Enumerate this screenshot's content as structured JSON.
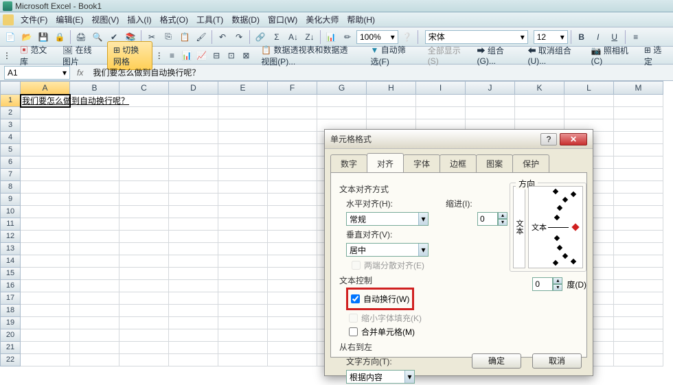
{
  "title": "Microsoft Excel - Book1",
  "menu": {
    "file": "文件(F)",
    "edit": "编辑(E)",
    "view": "视图(V)",
    "insert": "插入(I)",
    "format": "格式(O)",
    "tools": "工具(T)",
    "data": "数据(D)",
    "window": "窗口(W)",
    "beautify": "美化大师",
    "help": "帮助(H)"
  },
  "toolbar": {
    "zoom": "100%",
    "fontname": "宋体",
    "fontsize": "12",
    "bold": "B",
    "italic": "I",
    "underline": "U"
  },
  "strip2": {
    "fanwenku": "范文库",
    "online_image": "在线图片",
    "toggle_grid": "切换网格",
    "pivot": "数据透视表和数据透视图(P)...",
    "auto_filter": "自动筛选(F)",
    "show_all": "全部显示(S)",
    "group": "组合(G)...",
    "ungroup": "取消组合(U)...",
    "camera": "照相机(C)",
    "select": "选定"
  },
  "formula": {
    "cellref": "A1",
    "fx": "fx",
    "text": "我们要怎么做到自动换行呢？"
  },
  "grid": {
    "cols": [
      "A",
      "B",
      "C",
      "D",
      "E",
      "F",
      "G",
      "H",
      "I",
      "J",
      "K",
      "L",
      "M"
    ],
    "rows": [
      1,
      2,
      3,
      4,
      5,
      6,
      7,
      8,
      9,
      10,
      11,
      12,
      13,
      14,
      15,
      16,
      17,
      18,
      19,
      20,
      21,
      22
    ],
    "a1": "我们要怎么做到自动换行呢？"
  },
  "dialog": {
    "title": "单元格格式",
    "help": "?",
    "close": "✕",
    "tabs": {
      "number": "数字",
      "align": "对齐",
      "font": "字体",
      "border": "边框",
      "pattern": "图案",
      "protect": "保护"
    },
    "align": {
      "textalign_title": "文本对齐方式",
      "halign_label": "水平对齐(H):",
      "halign_value": "常规",
      "valign_label": "垂直对齐(V):",
      "valign_value": "居中",
      "justify_distributed": "两端分散对齐(E)",
      "indent_label": "缩进(I):",
      "indent_value": "0",
      "orient_title": "方向",
      "orient_vtext": "文本",
      "orient_htext": "文本",
      "degree_value": "0",
      "degree_label": "度(D)",
      "text_control_title": "文本控制",
      "wrap": "自动换行(W)",
      "shrink": "缩小字体填充(K)",
      "merge": "合并单元格(M)",
      "rtl_title": "从右到左",
      "textdir_label": "文字方向(T):",
      "textdir_value": "根据内容"
    },
    "ok": "确定",
    "cancel": "取消"
  }
}
